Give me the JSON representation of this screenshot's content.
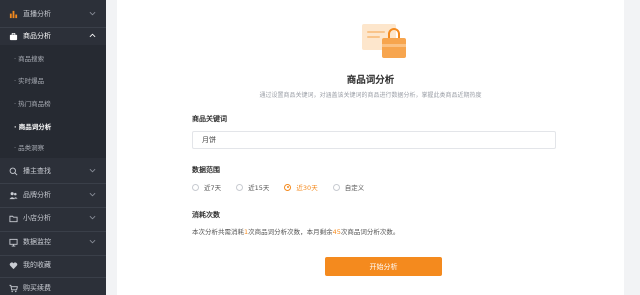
{
  "colors": {
    "accent": "#f48a1e",
    "sidebar_bg": "#2c3039"
  },
  "sidebar": {
    "items_top": [
      {
        "name": "sidebar-item-live-analysis",
        "label": "直播分析",
        "icon": "bar-chart-icon"
      },
      {
        "name": "sidebar-item-product-analysis",
        "label": "商品分析",
        "icon": "briefcase-icon"
      }
    ],
    "sub_items": [
      {
        "label": "· 商品搜索",
        "active": false
      },
      {
        "label": "· 实时爆品",
        "active": false
      },
      {
        "label": "· 热门商品榜",
        "active": false
      },
      {
        "label": "· 商品词分析",
        "active": true
      },
      {
        "label": "· 品类洞察",
        "active": false
      }
    ],
    "items_bottom": [
      {
        "name": "sidebar-item-streamer-search",
        "label": "播主查找",
        "icon": "search-icon"
      },
      {
        "name": "sidebar-item-brand-analysis",
        "label": "品牌分析",
        "icon": "users-icon"
      },
      {
        "name": "sidebar-item-shop-analysis",
        "label": "小店分析",
        "icon": "folder-icon"
      },
      {
        "name": "sidebar-item-data-monitor",
        "label": "数据监控",
        "icon": "monitor-icon"
      },
      {
        "name": "sidebar-item-favorites",
        "label": "我的收藏",
        "icon": "heart-icon"
      },
      {
        "name": "sidebar-item-purchase",
        "label": "购买续费",
        "icon": "cart-icon"
      }
    ]
  },
  "main": {
    "title": "商品词分析",
    "subtitle": "通过设置商品关键词，对涵盖该关键词的商品进行数据分析，掌握此类商品近期热度",
    "keyword_label": "商品关键词",
    "keyword_value": "月饼",
    "range_label": "数据范围",
    "range_options": [
      {
        "label": "近7天",
        "checked": false
      },
      {
        "label": "近15天",
        "checked": false
      },
      {
        "label": "近30天",
        "checked": true
      },
      {
        "label": "自定义",
        "checked": false
      }
    ],
    "consume_label": "消耗次数",
    "consume": {
      "part1": "本次分析共需消耗",
      "cost": "1",
      "part2": "次商品词分析次数，本月剩余",
      "remaining": "45",
      "part3": "次商品词分析次数。"
    },
    "start_button": "开始分析"
  }
}
